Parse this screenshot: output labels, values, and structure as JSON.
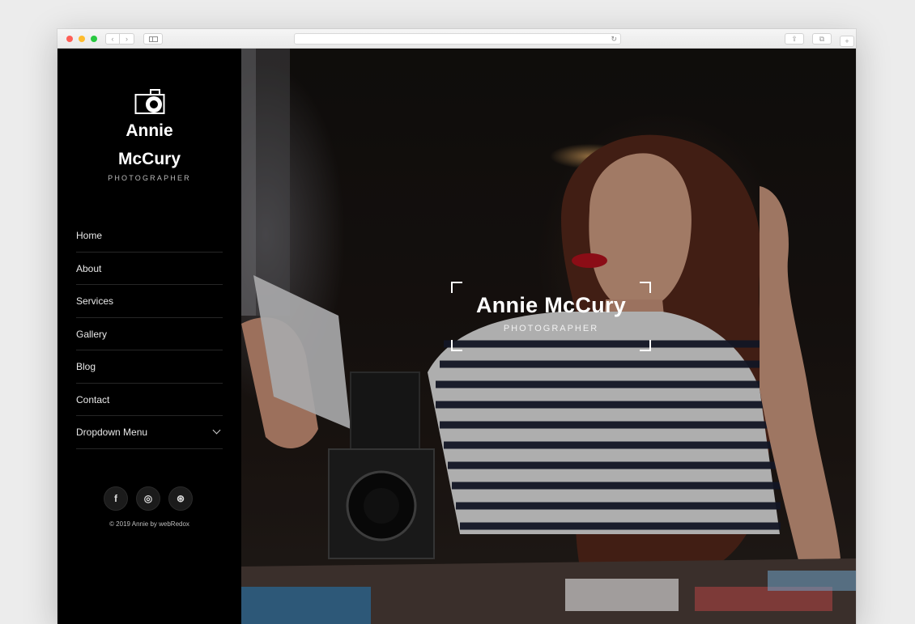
{
  "browser": {
    "reload_glyph": "↻",
    "back_glyph": "‹",
    "forward_glyph": "›",
    "share_glyph": "⇪",
    "tabs_glyph": "⧉",
    "newtab_glyph": "+"
  },
  "sidebar": {
    "brand_first": "Annie",
    "brand_last": "McCury",
    "subtitle": "PHOTOGRAPHER",
    "logo_icon": "camera-icon",
    "menu": [
      {
        "label": "Home"
      },
      {
        "label": "About"
      },
      {
        "label": "Services"
      },
      {
        "label": "Gallery"
      },
      {
        "label": "Blog"
      },
      {
        "label": "Contact"
      },
      {
        "label": "Dropdown Menu",
        "has_dropdown": true
      }
    ],
    "socials": [
      {
        "icon": "facebook-icon",
        "glyph": "f"
      },
      {
        "icon": "instagram-icon",
        "glyph": "◎"
      },
      {
        "icon": "dribbble-icon",
        "glyph": "⊛"
      }
    ],
    "copyright": "© 2019 Annie by webRedox"
  },
  "hero": {
    "title": "Annie McCury",
    "subtitle": "PHOTOGRAPHER"
  },
  "colors": {
    "sidebar_bg": "#000000",
    "text": "#ffffff",
    "divider": "#262626"
  }
}
